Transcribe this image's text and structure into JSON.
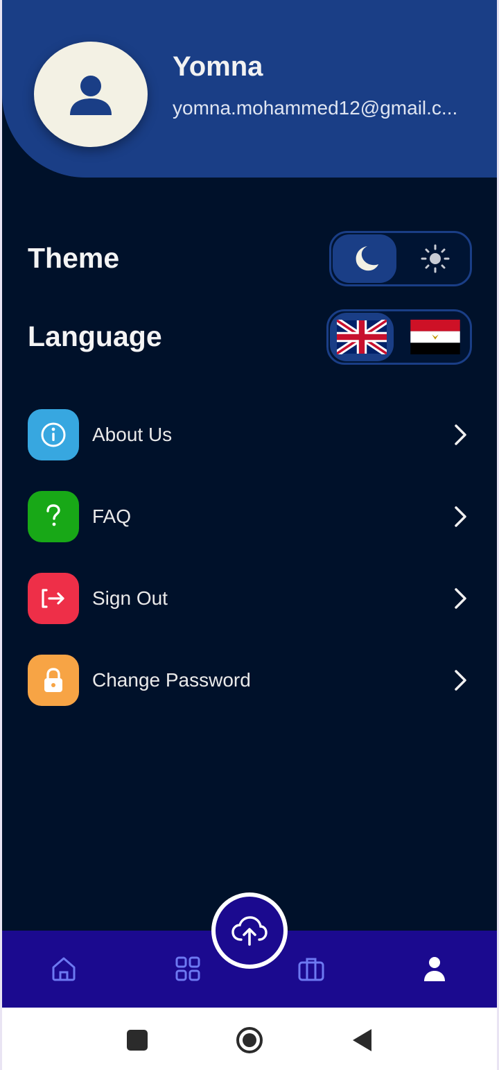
{
  "profile": {
    "name": "Yomna",
    "email": "yomna.mohammed12@gmail.c..."
  },
  "settings": {
    "theme_label": "Theme",
    "theme_selected": "dark",
    "language_label": "Language",
    "language_selected": "english"
  },
  "menu": [
    {
      "label": "About Us",
      "icon": "info-icon",
      "color": "#37a7e0"
    },
    {
      "label": "FAQ",
      "icon": "question-icon",
      "color": "#18a817"
    },
    {
      "label": "Sign Out",
      "icon": "sign-out-icon",
      "color": "#ee2f48"
    },
    {
      "label": "Change Password",
      "icon": "lock-icon",
      "color": "#f7a445"
    }
  ],
  "bottom_nav": {
    "items": [
      "home-icon",
      "grid-icon",
      "briefcase-icon",
      "profile-icon"
    ],
    "active": "profile-icon",
    "fab_icon": "cloud-upload-icon"
  },
  "colors": {
    "background": "#00112a",
    "header": "#1a3e86",
    "nav": "#1b0a8f"
  }
}
